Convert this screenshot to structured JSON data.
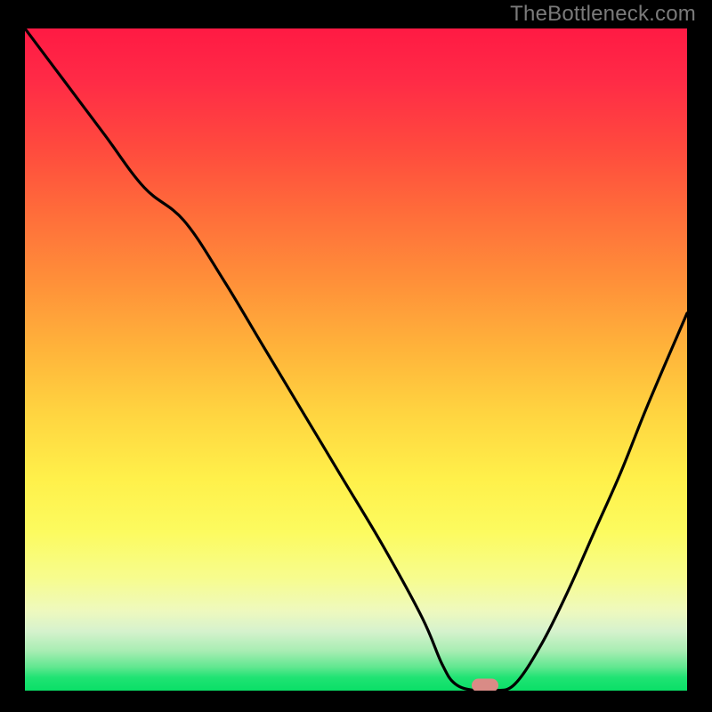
{
  "watermark": {
    "text": "TheBottleneck.com"
  },
  "colors": {
    "page_bg": "#000000",
    "curve_stroke": "#000000",
    "marker_fill": "#d98b86",
    "watermark_color": "#7a7a7a"
  },
  "chart_data": {
    "type": "line",
    "title": "",
    "xlabel": "",
    "ylabel": "",
    "xlim": [
      0,
      100
    ],
    "ylim": [
      0,
      100
    ],
    "grid": false,
    "series": [
      {
        "name": "bottleneck-curve",
        "x": [
          0,
          6,
          12,
          18,
          24,
          30,
          36,
          42,
          48,
          54,
          60,
          63,
          65,
          68,
          71,
          74,
          78,
          82,
          86,
          90,
          94,
          100
        ],
        "values": [
          100,
          92,
          84,
          76,
          71,
          62,
          52,
          42,
          32,
          22,
          11,
          4,
          1,
          0,
          0,
          1,
          7,
          15,
          24,
          33,
          43,
          57
        ]
      }
    ],
    "marker": {
      "x": 69.5,
      "y": 0
    },
    "background_gradient": [
      {
        "stop": 0,
        "color": "#ff1a44"
      },
      {
        "stop": 0.68,
        "color": "#fff04a"
      },
      {
        "stop": 0.98,
        "color": "#20e373"
      },
      {
        "stop": 1.0,
        "color": "#0adf67"
      }
    ]
  }
}
